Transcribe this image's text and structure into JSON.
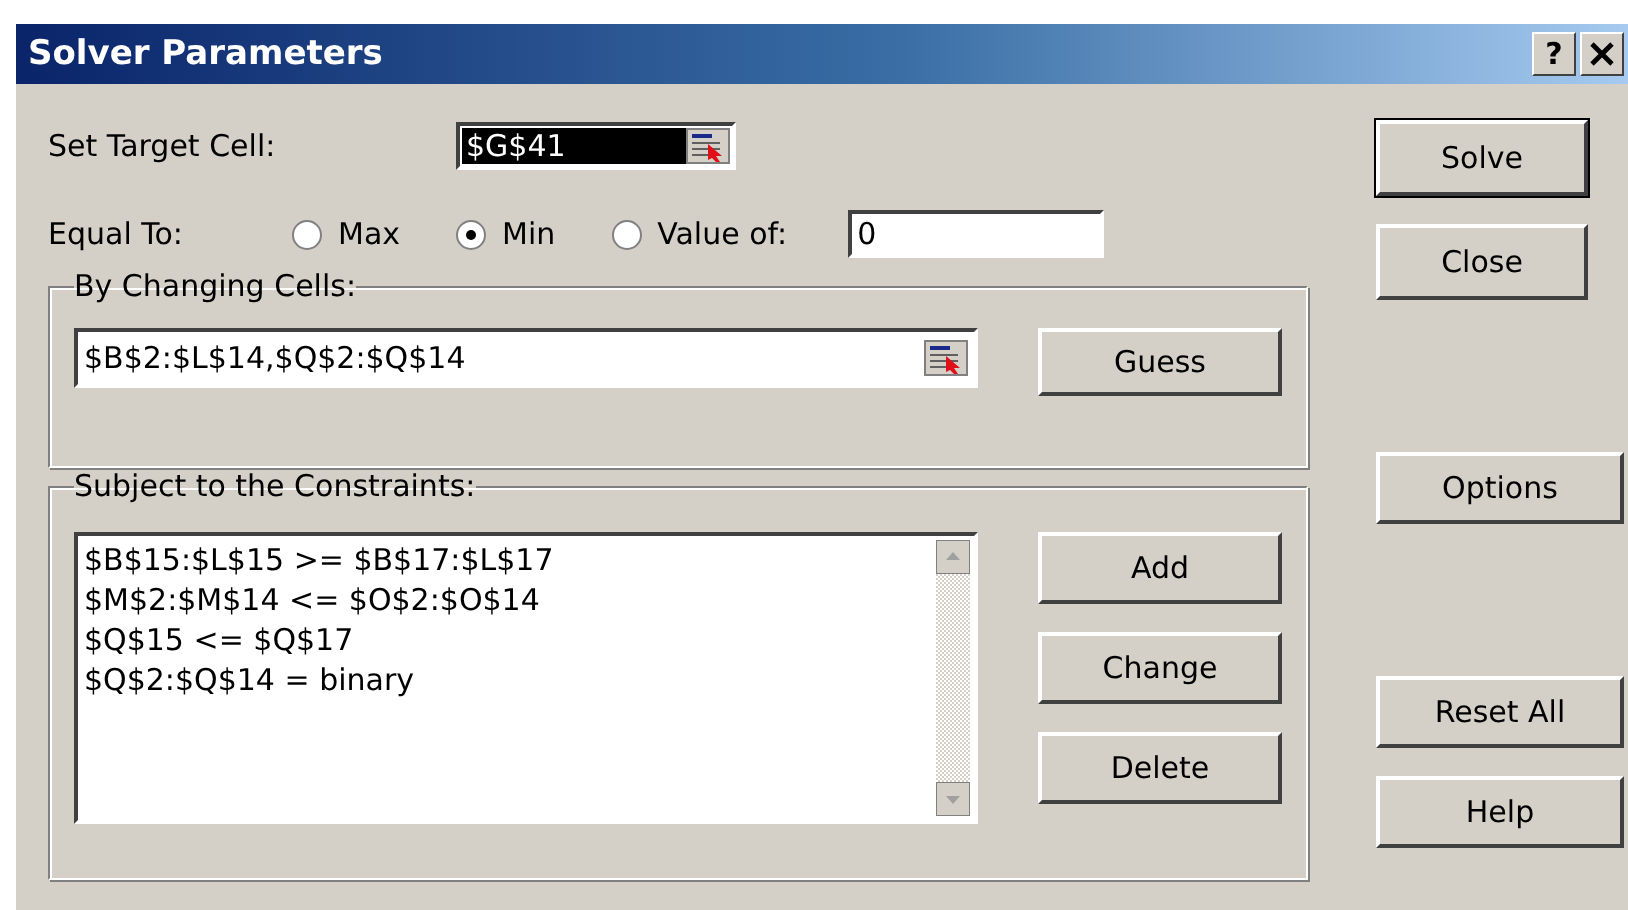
{
  "window": {
    "title": "Solver Parameters",
    "help_glyph": "?"
  },
  "target_cell": {
    "label": "Set Target Cell:",
    "value": "$G$41",
    "selected": true
  },
  "equal_to": {
    "label": "Equal To:",
    "options": [
      {
        "label": "Max",
        "selected": false
      },
      {
        "label": "Min",
        "selected": true
      },
      {
        "label": "Value of:",
        "selected": false
      }
    ],
    "value": "0"
  },
  "changing_cells": {
    "title": "By Changing Cells:",
    "value": "$B$2:$L$14,$Q$2:$Q$14",
    "button": "Guess"
  },
  "constraints": {
    "title": "Subject to the Constraints:",
    "items": [
      "$B$15:$L$15 >= $B$17:$L$17",
      "$M$2:$M$14 <= $O$2:$O$14",
      "$Q$15 <= $Q$17",
      "$Q$2:$Q$14 = binary"
    ],
    "buttons": [
      "Add",
      "Change",
      "Delete"
    ]
  },
  "side_buttons": [
    {
      "label": "Solve",
      "default": true
    },
    {
      "label": "Close",
      "default": false
    },
    {
      "label": "Options",
      "default": false
    },
    {
      "label": "Reset All",
      "default": false
    },
    {
      "label": "Help",
      "default": false
    }
  ]
}
